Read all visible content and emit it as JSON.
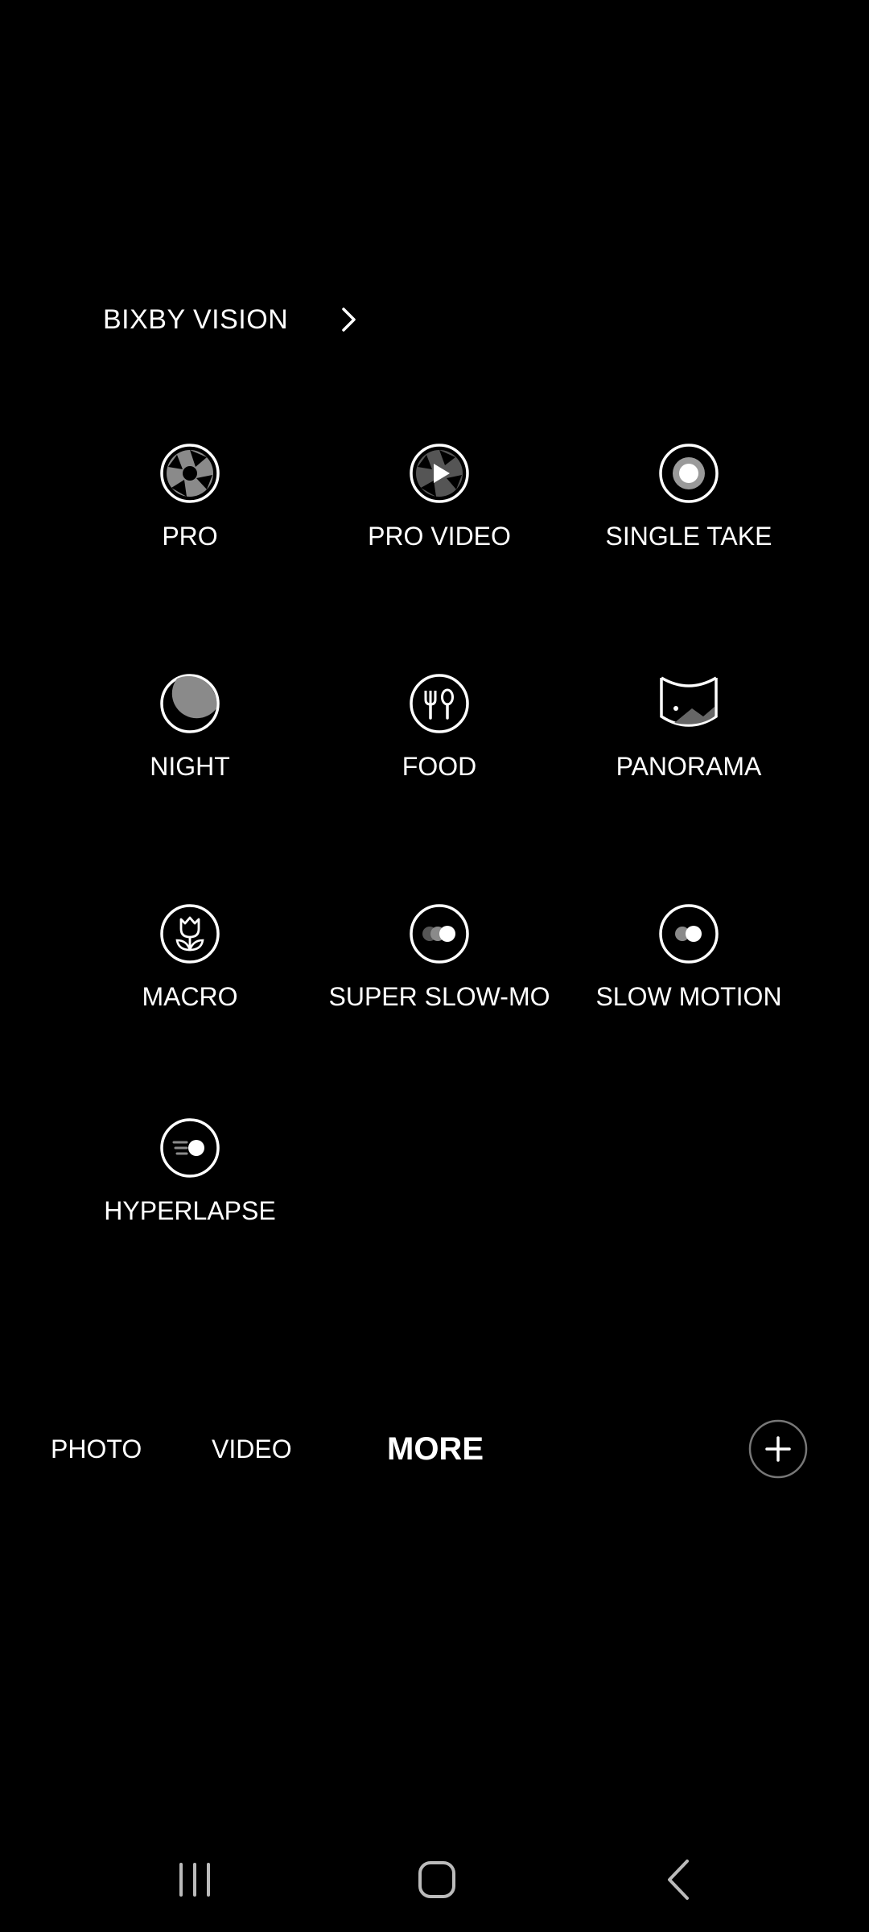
{
  "bixby": {
    "label": "BIXBY VISION",
    "icon": "chevron-right-icon"
  },
  "modes": [
    {
      "label": "PRO",
      "icon": "aperture-icon"
    },
    {
      "label": "PRO VIDEO",
      "icon": "aperture-play-icon"
    },
    {
      "label": "SINGLE TAKE",
      "icon": "single-take-icon"
    },
    {
      "label": "NIGHT",
      "icon": "moon-icon"
    },
    {
      "label": "FOOD",
      "icon": "fork-spoon-icon"
    },
    {
      "label": "PANORAMA",
      "icon": "panorama-icon"
    },
    {
      "label": "MACRO",
      "icon": "flower-icon"
    },
    {
      "label": "SUPER SLOW-MO",
      "icon": "super-slow-mo-icon"
    },
    {
      "label": "SLOW MOTION",
      "icon": "slow-motion-icon"
    },
    {
      "label": "HYPERLAPSE",
      "icon": "hyperlapse-icon"
    }
  ],
  "tabs": [
    {
      "label": "PHOTO",
      "active": false
    },
    {
      "label": "VIDEO",
      "active": false
    },
    {
      "label": "MORE",
      "active": true
    }
  ],
  "add_button": {
    "icon": "plus-icon"
  },
  "nav": {
    "recents": "recent-apps-icon",
    "home": "home-icon",
    "back": "back-icon"
  },
  "colors": {
    "background": "#000000",
    "foreground": "#ffffff",
    "icon_fill": "#8a8a8a",
    "icon_dark": "#555555",
    "ring": "#9a9a9a"
  }
}
